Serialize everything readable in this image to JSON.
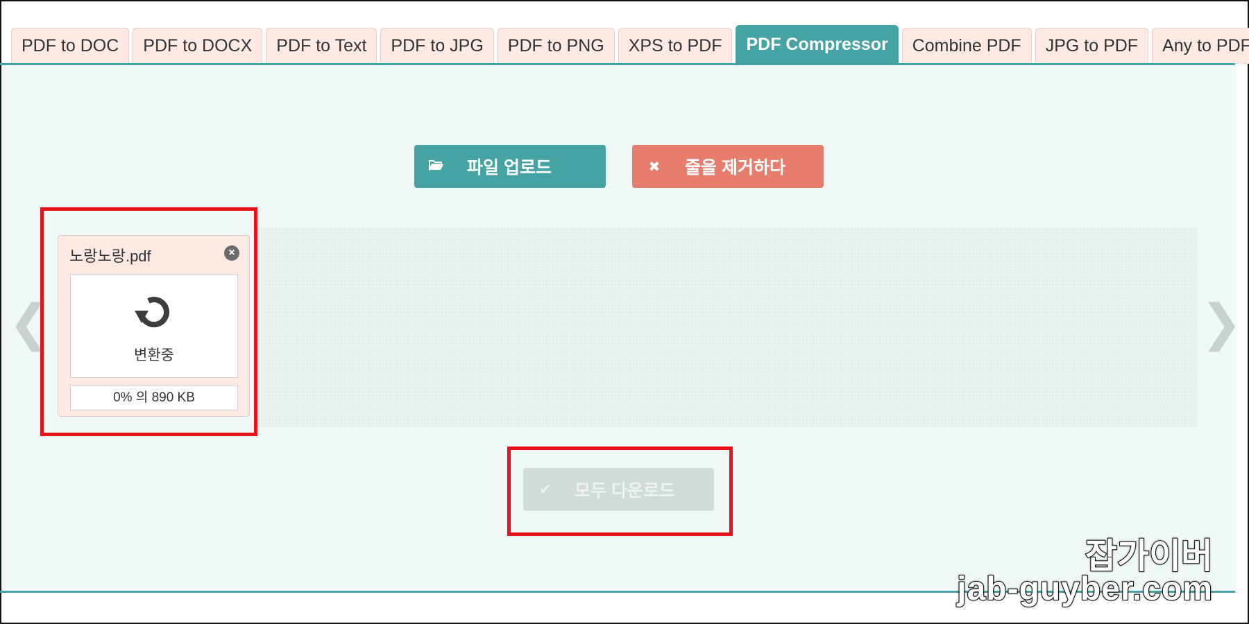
{
  "tabs": [
    {
      "label": "PDF to DOC"
    },
    {
      "label": "PDF to DOCX"
    },
    {
      "label": "PDF to Text"
    },
    {
      "label": "PDF to JPG"
    },
    {
      "label": "PDF to PNG"
    },
    {
      "label": "XPS to PDF"
    },
    {
      "label": "PDF Compressor",
      "active": true
    },
    {
      "label": "Combine PDF"
    },
    {
      "label": "JPG to PDF"
    },
    {
      "label": "Any to PDF"
    }
  ],
  "toolbar": {
    "upload_label": "파일 업로드",
    "upload_icon": "folder-open-icon",
    "remove_label": "줄을 제거하다",
    "remove_icon": "close-icon"
  },
  "file": {
    "name": "노랑노랑.pdf",
    "status": "변환중",
    "progress_text": "0% 의 890 KB"
  },
  "download": {
    "label": "모두 다운로드",
    "icon": "check-icon"
  },
  "watermark": {
    "line1": "잡가이버",
    "line2": "jab-guyber.com"
  },
  "colors": {
    "accent": "#45a3a3",
    "remove": "#e77d6c",
    "highlight": "#e8121a"
  }
}
